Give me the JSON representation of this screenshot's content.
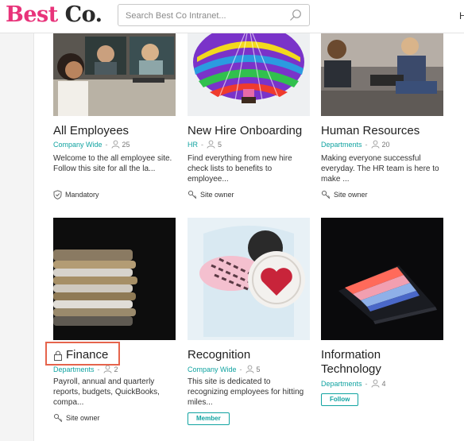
{
  "header": {
    "logo_best": "Best",
    "logo_co": "Co.",
    "search_placeholder": "Search Best Co Intranet...",
    "truncated_right": "H"
  },
  "cards": [
    {
      "title": "All Employees",
      "category": "Company Wide",
      "members": "25",
      "description": "Welcome to the all employee site. Follow this site for all the la...",
      "footer_text": "Mandatory",
      "footer_icon": "shield-check-icon"
    },
    {
      "title": "New Hire Onboarding",
      "category": "HR",
      "members": "5",
      "description": "Find everything from new hire check lists to benefits to employee...",
      "footer_text": "Site owner",
      "footer_icon": "key-icon"
    },
    {
      "title": "Human Resources",
      "category": "Departments",
      "members": "20",
      "description": "Making everyone successful everyday. The HR team is here to make ...",
      "footer_text": "Site owner",
      "footer_icon": "key-icon"
    },
    {
      "title": "Finance",
      "title_icon": "lock-icon",
      "category": "Departments",
      "members": "2",
      "description": "Payroll, annual and quarterly reports, budgets, QuickBooks, compa...",
      "footer_text": "Site owner",
      "footer_icon": "key-icon"
    },
    {
      "title": "Recognition",
      "category": "Company Wide",
      "members": "5",
      "description": "This site is dedicated to recognizing employees for hitting miles...",
      "button": "Member"
    },
    {
      "title": "Information Technology",
      "category": "Departments",
      "members": "4",
      "button": "Follow"
    }
  ],
  "colors": {
    "brand": "#e8337a",
    "accent": "#11a3a1",
    "highlight": "#e5644c"
  }
}
